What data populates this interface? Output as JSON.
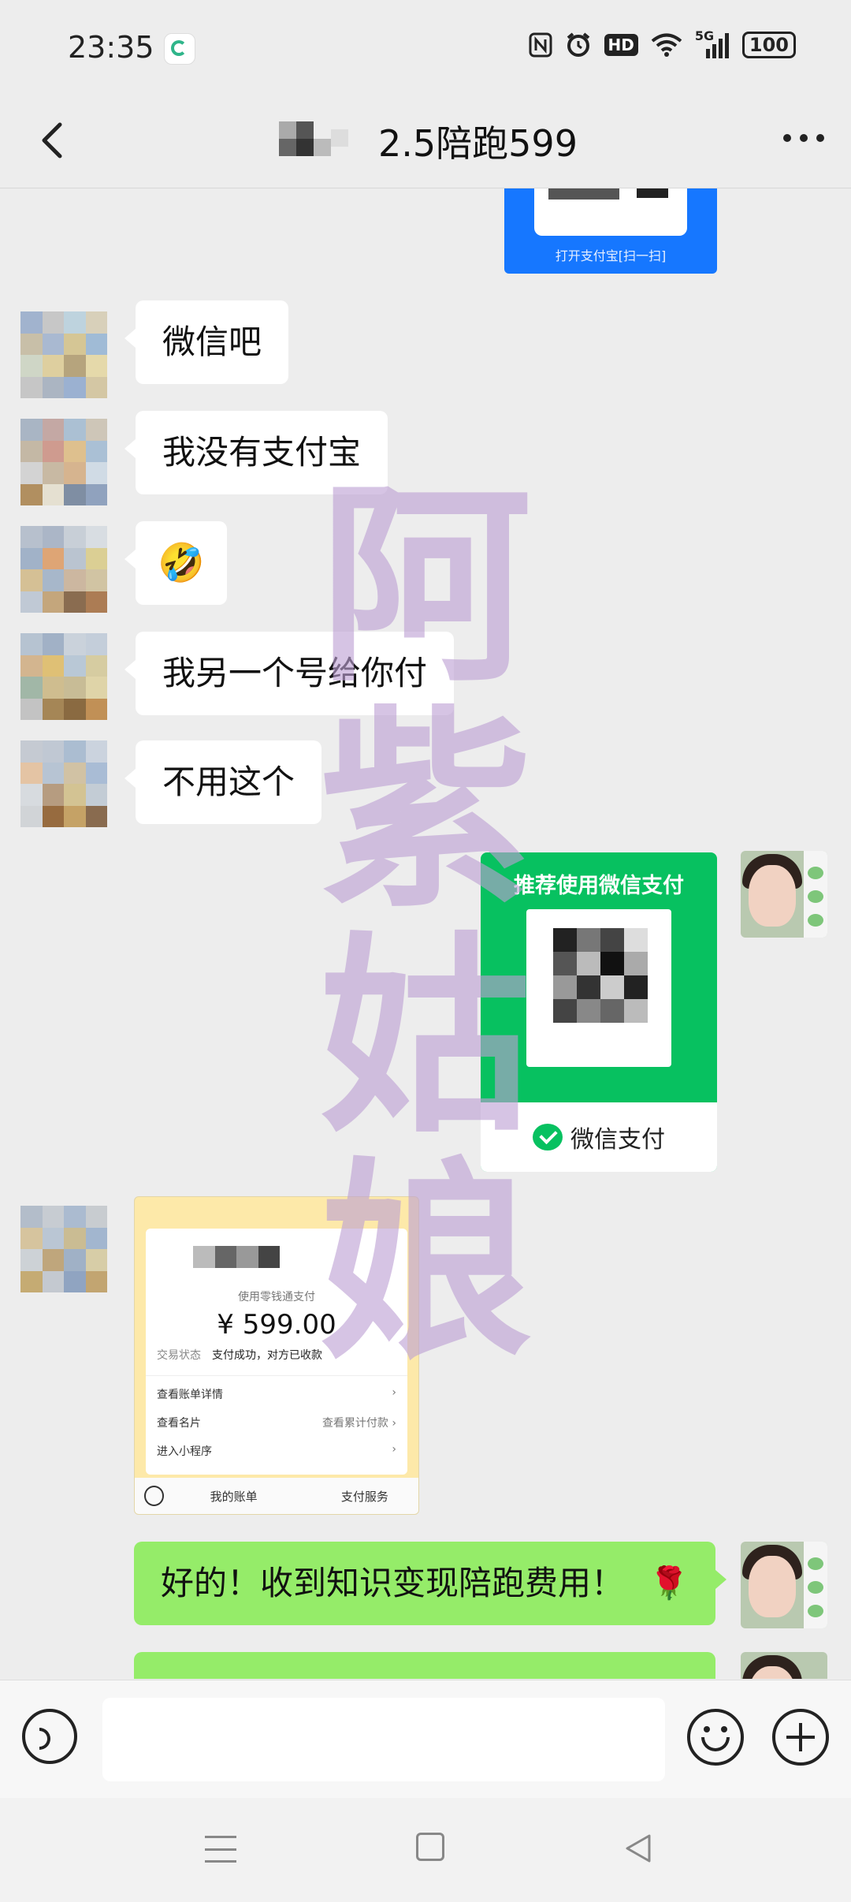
{
  "status_bar": {
    "time": "23:35",
    "icons": [
      "nfc-icon",
      "alarm-icon",
      "hd-icon",
      "wifi-icon",
      "signal-5g-icon"
    ],
    "hd": "HD",
    "network": "5G",
    "battery": "100"
  },
  "header": {
    "title": "2.5陪跑599",
    "back_icon": "back-chevron-icon",
    "more_icon": "more-dots-icon"
  },
  "messages": {
    "alipay_caption": "打开支付宝[扫一扫]",
    "m1": "微信吧",
    "m2": "我没有支付宝",
    "m3_emoji": "🤣",
    "m4": "我另一个号给你付",
    "m5": "不用这个",
    "wechat_pay_card": {
      "header": "推荐使用微信支付",
      "footer": "微信支付"
    },
    "receipt": {
      "method": "使用零钱通支付",
      "amount": "¥ 599.00",
      "status_label": "交易状态",
      "status_value": "支付成功，对方已收款",
      "row1": "查看账单详情",
      "row2": "查看名片",
      "row2_right": "查看累计付款",
      "row3": "进入小程序",
      "bottom_left": "我的账单",
      "bottom_right": "支付服务"
    },
    "mine1": "好的！收到知识变现陪跑费用！",
    "mine1_emoji": "🌹"
  },
  "watermark": [
    "阿",
    "紫",
    "姑",
    "娘"
  ],
  "colors": {
    "chat_bg": "#ededed",
    "my_bubble": "#95ec69",
    "wechat_green": "#07c160",
    "alipay_blue": "#1677ff",
    "watermark": "#bda0d4"
  }
}
